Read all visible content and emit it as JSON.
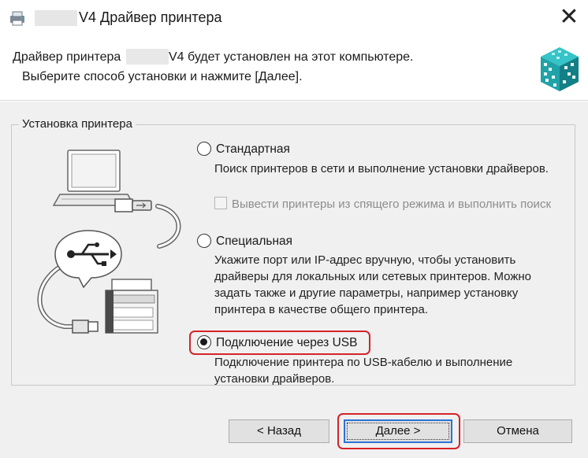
{
  "window": {
    "title": "V4 Драйвер принтера",
    "close_glyph": "✕",
    "app_icon": "printer-driver-icon"
  },
  "header": {
    "line1_start": "Драйвер принтера",
    "line1_end": "V4 будет установлен на этот компьютере.",
    "line2": "Выберите способ установки и нажмите [Далее].",
    "icon": "install-package-icon"
  },
  "group": {
    "label": "Установка принтера"
  },
  "options": [
    {
      "label": "Стандартная",
      "description": "Поиск принтеров в сети и выполнение установки драйверов.",
      "selected": false
    },
    {
      "label": "Специальная",
      "description": "Укажите порт или IP-адрес вручную, чтобы установить драйверы для локальных или сетевых принтеров. Можно задать также и другие параметры, например установку принтера в качестве общего принтера.",
      "selected": false
    },
    {
      "label": "Подключение через USB",
      "description": "Подключение принтера по USB-кабелю и выполнение установки драйверов.",
      "selected": true
    }
  ],
  "wake_checkbox": {
    "label": "Вывести принтеры из спящего режима и выполнить поиск",
    "checked": false,
    "enabled": false
  },
  "buttons": {
    "back": "< Назад",
    "next": "Далее >",
    "cancel": "Отмена"
  },
  "colors": {
    "highlight": "#d6232a",
    "focus": "#2a73d6",
    "body_bg": "#f0f0f0"
  }
}
